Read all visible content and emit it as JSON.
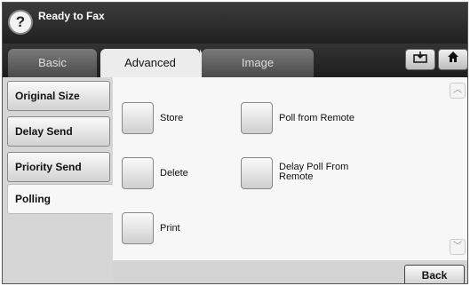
{
  "header": {
    "title": "Ready to Fax",
    "help_glyph": "?"
  },
  "tabs": [
    {
      "label": "Basic",
      "active": false
    },
    {
      "label": "Advanced",
      "active": true
    },
    {
      "label": "Image",
      "active": false
    }
  ],
  "toolbar": {
    "store_icon": "tray-icon",
    "home_icon": "home-icon"
  },
  "sidebar": {
    "items": [
      {
        "label": "Original Size",
        "selected": false
      },
      {
        "label": "Delay Send",
        "selected": false
      },
      {
        "label": "Priority Send",
        "selected": false
      },
      {
        "label": "Polling",
        "selected": true
      }
    ]
  },
  "options": {
    "store": "Store",
    "delete": "Delete",
    "print": "Print",
    "poll_from_remote": "Poll from Remote",
    "delay_poll_line1": "Delay Poll From",
    "delay_poll_line2": "Remote"
  },
  "scroll": {
    "up": "︿",
    "down": "﹀"
  },
  "back_label": "Back",
  "colors": {
    "topbar": "#2a2a2a",
    "selected_tab": "#ececec",
    "pane": "#f7f7f7"
  }
}
